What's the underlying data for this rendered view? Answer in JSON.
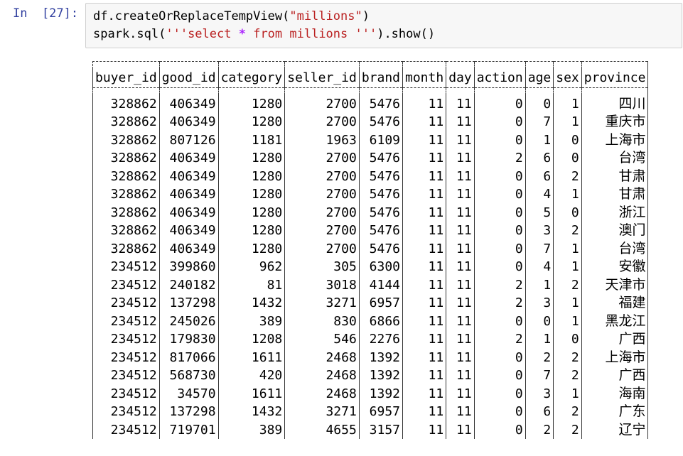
{
  "cell": {
    "prompt": "In  [27]:",
    "code_line1": {
      "a": "df.createOrReplaceTempView(",
      "b": "\"millions\"",
      "c": ")"
    },
    "code_line2": {
      "a": "spark.sql(",
      "b": "'''select ",
      "op": "*",
      "c": " from millions '''",
      "d": ").show()"
    }
  },
  "output": {
    "columns": [
      "buyer_id",
      "good_id",
      "category",
      "seller_id",
      "brand",
      "month",
      "day",
      "action",
      "age",
      "sex",
      "province"
    ],
    "rows": [
      [
        "328862",
        "406349",
        "1280",
        "2700",
        "5476",
        "11",
        "11",
        "0",
        "0",
        "1",
        "四川"
      ],
      [
        "328862",
        "406349",
        "1280",
        "2700",
        "5476",
        "11",
        "11",
        "0",
        "7",
        "1",
        "重庆市"
      ],
      [
        "328862",
        "807126",
        "1181",
        "1963",
        "6109",
        "11",
        "11",
        "0",
        "1",
        "0",
        "上海市"
      ],
      [
        "328862",
        "406349",
        "1280",
        "2700",
        "5476",
        "11",
        "11",
        "2",
        "6",
        "0",
        "台湾"
      ],
      [
        "328862",
        "406349",
        "1280",
        "2700",
        "5476",
        "11",
        "11",
        "0",
        "6",
        "2",
        "甘肃"
      ],
      [
        "328862",
        "406349",
        "1280",
        "2700",
        "5476",
        "11",
        "11",
        "0",
        "4",
        "1",
        "甘肃"
      ],
      [
        "328862",
        "406349",
        "1280",
        "2700",
        "5476",
        "11",
        "11",
        "0",
        "5",
        "0",
        "浙江"
      ],
      [
        "328862",
        "406349",
        "1280",
        "2700",
        "5476",
        "11",
        "11",
        "0",
        "3",
        "2",
        "澳门"
      ],
      [
        "328862",
        "406349",
        "1280",
        "2700",
        "5476",
        "11",
        "11",
        "0",
        "7",
        "1",
        "台湾"
      ],
      [
        "234512",
        "399860",
        "962",
        "305",
        "6300",
        "11",
        "11",
        "0",
        "4",
        "1",
        "安徽"
      ],
      [
        "234512",
        "240182",
        "81",
        "3018",
        "4144",
        "11",
        "11",
        "2",
        "1",
        "2",
        "天津市"
      ],
      [
        "234512",
        "137298",
        "1432",
        "3271",
        "6957",
        "11",
        "11",
        "2",
        "3",
        "1",
        "福建"
      ],
      [
        "234512",
        "245026",
        "389",
        "830",
        "6866",
        "11",
        "11",
        "0",
        "0",
        "1",
        "黑龙江"
      ],
      [
        "234512",
        "179830",
        "1208",
        "546",
        "2276",
        "11",
        "11",
        "2",
        "1",
        "0",
        "广西"
      ],
      [
        "234512",
        "817066",
        "1611",
        "2468",
        "1392",
        "11",
        "11",
        "0",
        "2",
        "2",
        "上海市"
      ],
      [
        "234512",
        "568730",
        "420",
        "2468",
        "1392",
        "11",
        "11",
        "0",
        "7",
        "2",
        "广西"
      ],
      [
        "234512",
        "34570",
        "1611",
        "2468",
        "1392",
        "11",
        "11",
        "0",
        "3",
        "1",
        "海南"
      ],
      [
        "234512",
        "137298",
        "1432",
        "3271",
        "6957",
        "11",
        "11",
        "0",
        "6",
        "2",
        "广东"
      ],
      [
        "234512",
        "719701",
        "389",
        "4655",
        "3157",
        "11",
        "11",
        "0",
        "2",
        "2",
        "辽宁"
      ]
    ]
  }
}
